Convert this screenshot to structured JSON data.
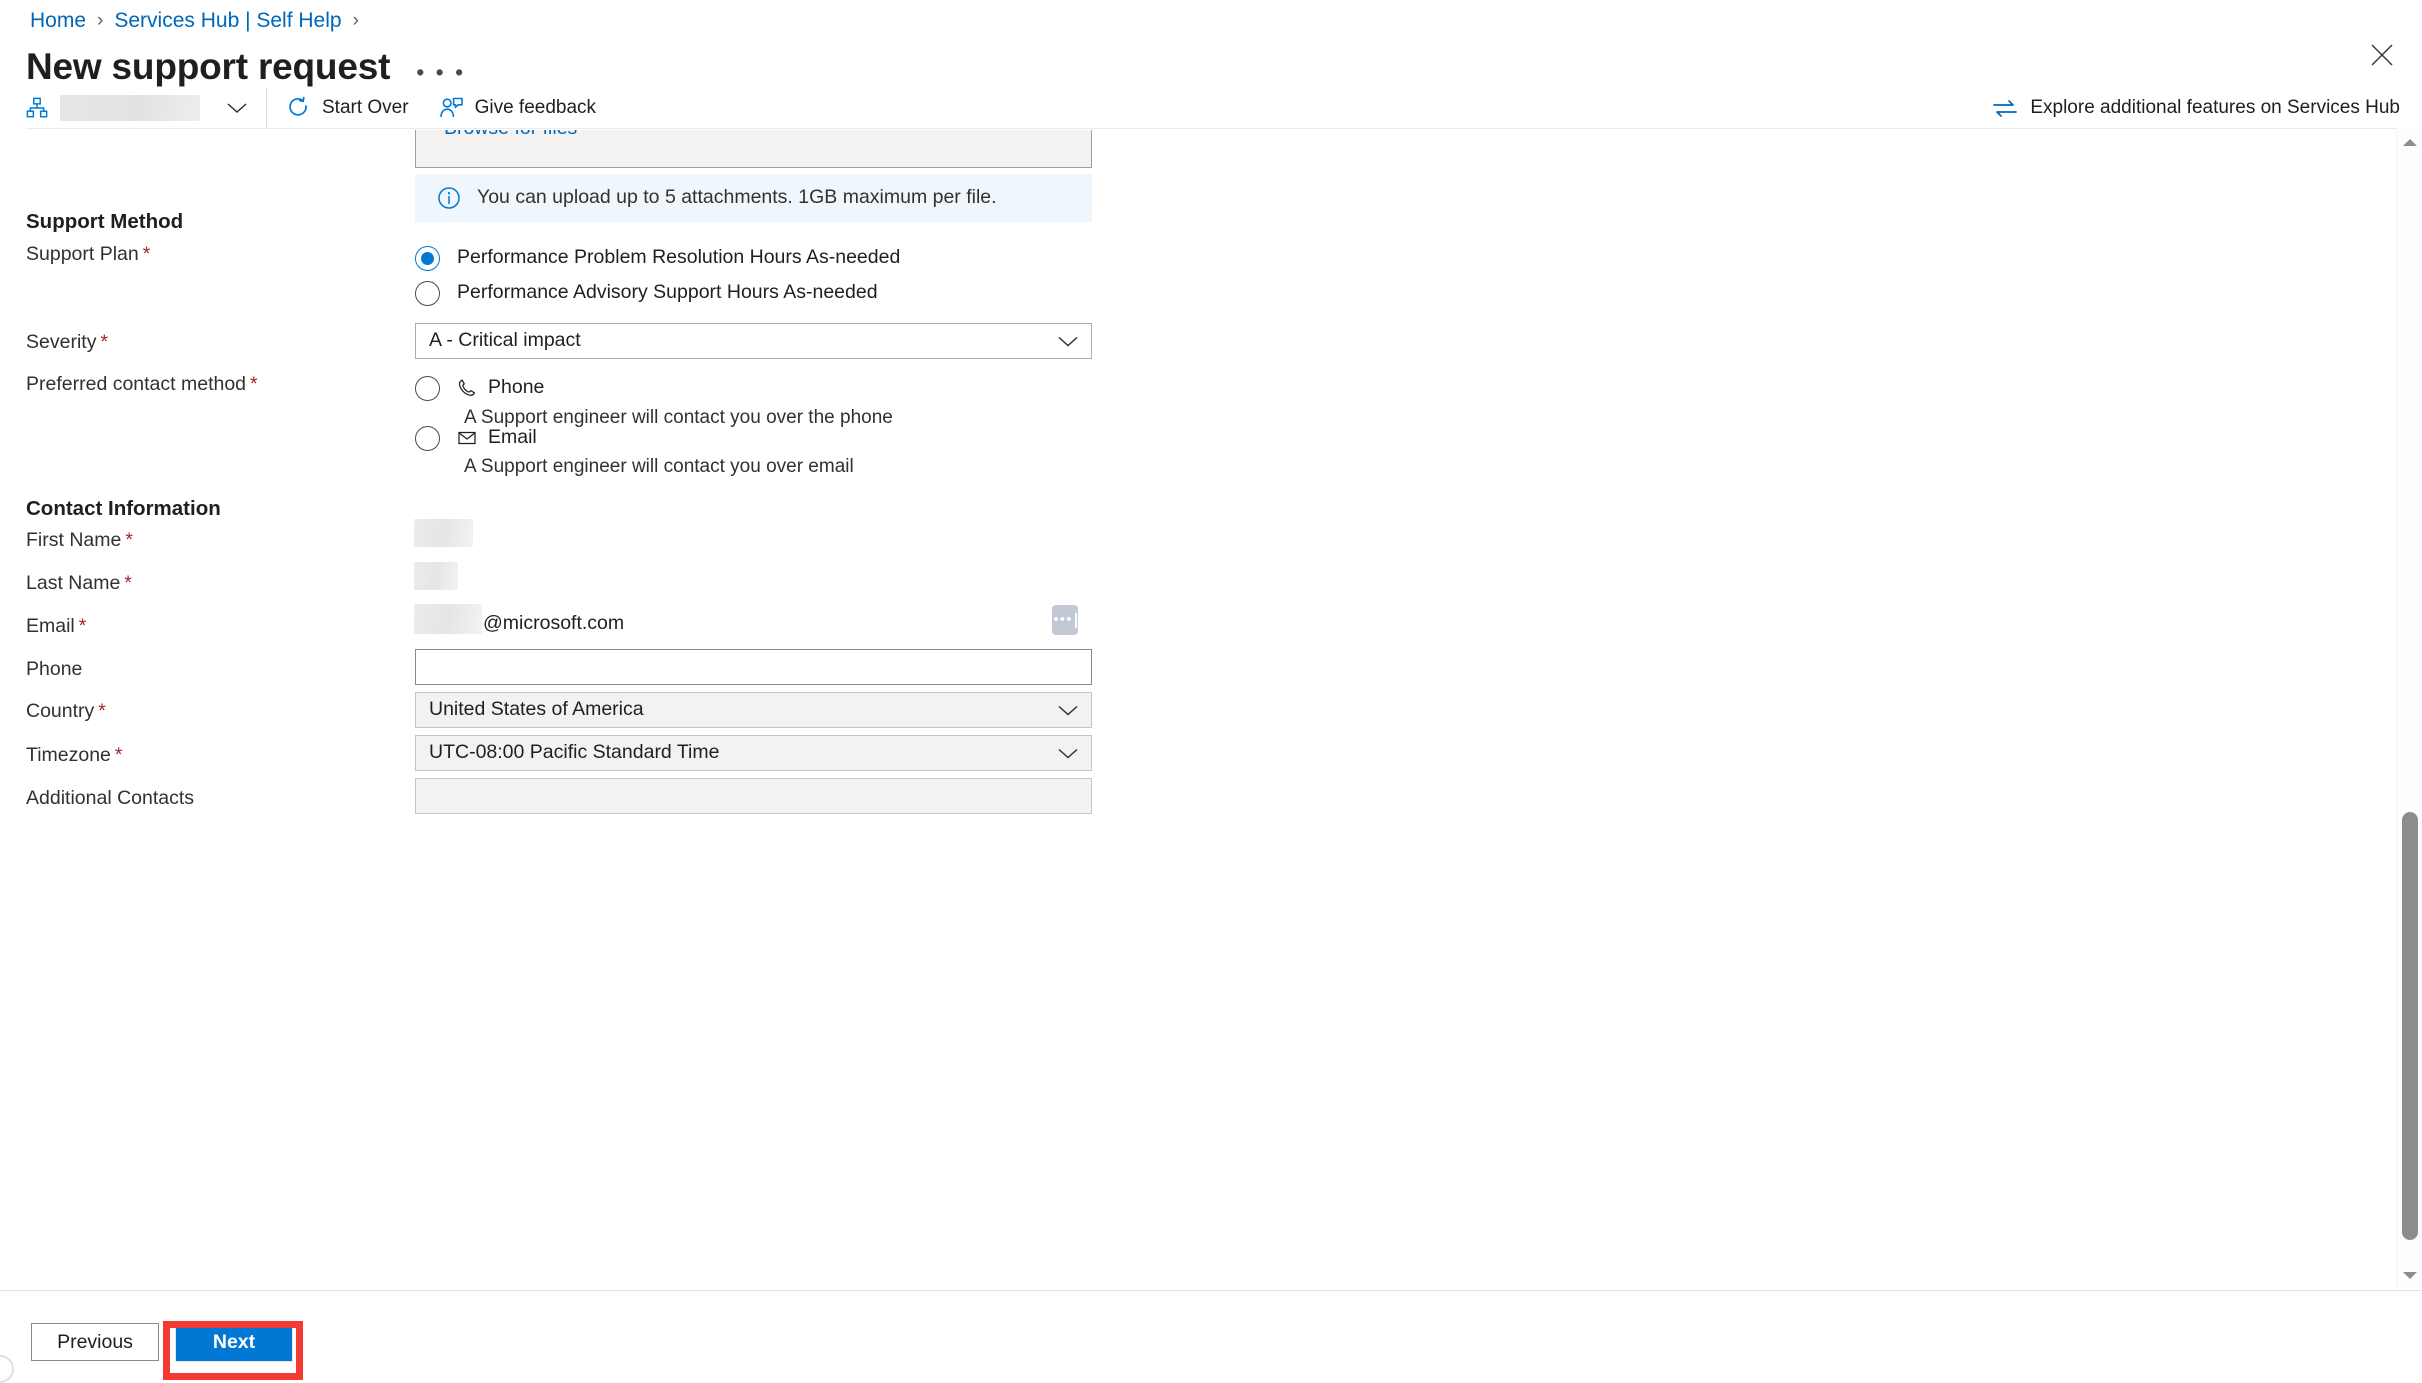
{
  "breadcrumb": {
    "items": [
      {
        "label": "Home",
        "link": true
      },
      {
        "label": "Services Hub | Self Help",
        "link": true
      }
    ],
    "separator": "›"
  },
  "header": {
    "title": "New support request",
    "more_label": "• • •",
    "close_icon": "close-icon"
  },
  "command_bar": {
    "subscription_icon": "hierarchy-icon",
    "subscription_value": "",
    "chevron_icon": "chevron-down-icon",
    "buttons": [
      {
        "label": "Start Over",
        "icon": "refresh-icon"
      },
      {
        "label": "Give feedback",
        "icon": "feedback-person-icon"
      }
    ],
    "explore": {
      "label": "Explore additional features on Services Hub",
      "icon": "swap-arrows-icon"
    }
  },
  "attachments": {
    "browse_label": "Browse for files",
    "note": "You can upload up to 5 attachments. 1GB maximum per file.",
    "note_icon": "info-icon"
  },
  "support_method": {
    "heading": "Support Method",
    "support_plan": {
      "label": "Support Plan",
      "required": "*",
      "options": [
        {
          "label": "Performance Problem Resolution Hours As-needed",
          "selected": true
        },
        {
          "label": "Performance Advisory Support Hours As-needed",
          "selected": false
        }
      ]
    },
    "severity": {
      "label": "Severity",
      "required": "*",
      "value": "A - Critical impact",
      "chevron_icon": "chevron-down-icon"
    },
    "preferred_contact_method": {
      "label": "Preferred contact method",
      "required": "*",
      "options": [
        {
          "label": "Phone",
          "icon": "phone-icon",
          "description": "A Support engineer will contact you over the phone",
          "selected": false
        },
        {
          "label": "Email",
          "icon": "mail-icon",
          "description": "A Support engineer will contact you over email",
          "selected": false
        }
      ]
    }
  },
  "contact_information": {
    "heading": "Contact Information",
    "fields": {
      "first_name": {
        "label": "First Name",
        "required": "*",
        "value": ""
      },
      "last_name": {
        "label": "Last Name",
        "required": "*",
        "value": ""
      },
      "email": {
        "label": "Email",
        "required": "*",
        "value": "",
        "domain": "@microsoft.com",
        "more_icon": "ellipsis-icon"
      },
      "phone": {
        "label": "Phone",
        "required": "",
        "value": "",
        "placeholder": ""
      },
      "country": {
        "label": "Country",
        "required": "*",
        "value": "United States of America",
        "chevron_icon": "chevron-down-icon"
      },
      "timezone": {
        "label": "Timezone",
        "required": "*",
        "value": "UTC-08:00 Pacific Standard Time",
        "chevron_icon": "chevron-down-icon"
      },
      "additional_contacts": {
        "label": "Additional Contacts",
        "required": "",
        "value": "",
        "placeholder": ""
      }
    }
  },
  "footer": {
    "previous_label": "Previous",
    "next_label": "Next"
  },
  "scrollbar": {
    "up_icon": "scroll-up-arrow-icon",
    "down_icon": "scroll-down-arrow-icon"
  },
  "colors": {
    "accent": "#0078d4",
    "link": "#0067b8",
    "required_asterisk": "#a4262c",
    "info_banner_bg": "#eff6fc",
    "highlight_box": "#f33b33",
    "text_primary": "#201f1e"
  }
}
